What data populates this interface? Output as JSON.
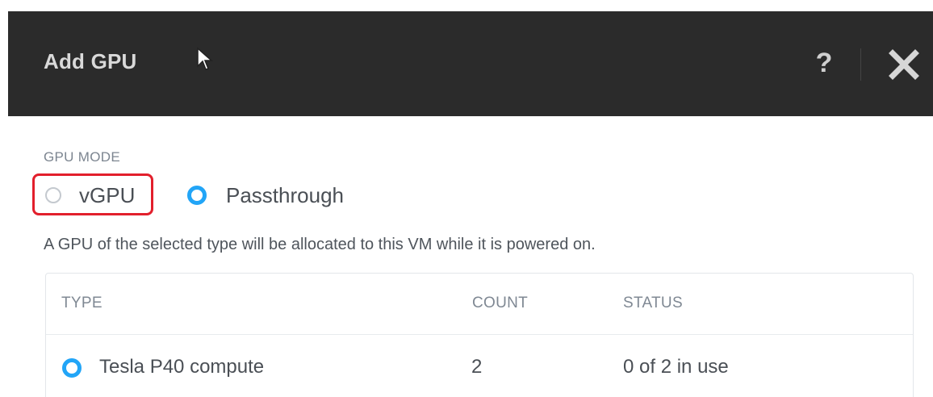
{
  "dialog": {
    "title": "Add GPU",
    "help_label": "?"
  },
  "gpu_mode": {
    "label": "GPU MODE",
    "options": [
      {
        "label": "vGPU",
        "selected": false
      },
      {
        "label": "Passthrough",
        "selected": true
      }
    ]
  },
  "description": "A GPU of the selected type will be allocated to this VM while it is powered on.",
  "table": {
    "columns": [
      "TYPE",
      "COUNT",
      "STATUS"
    ],
    "rows": [
      {
        "type": "Tesla P40 compute",
        "count": "2",
        "status": "0 of 2 in use",
        "selected": true
      }
    ]
  },
  "colors": {
    "header_bg": "#2b2b2b",
    "accent": "#22a5f7",
    "highlight": "#e21f2c"
  }
}
